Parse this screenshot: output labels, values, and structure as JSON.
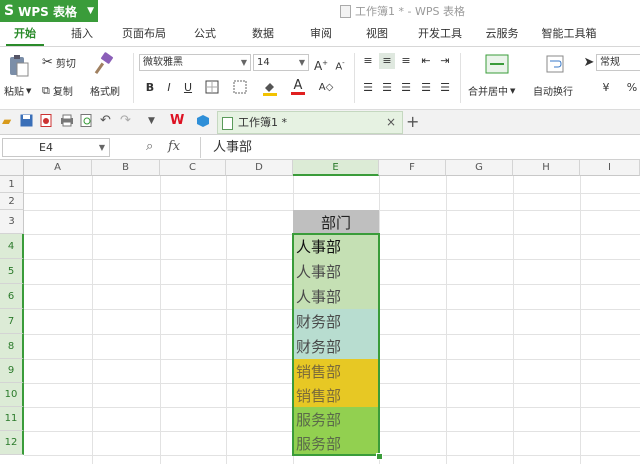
{
  "app": {
    "name": "WPS 表格",
    "logo": "S"
  },
  "window": {
    "title": "工作簿1 * - WPS 表格"
  },
  "tabs": [
    "开始",
    "插入",
    "页面布局",
    "公式",
    "数据",
    "审阅",
    "视图",
    "开发工具",
    "云服务",
    "智能工具箱"
  ],
  "ribbon": {
    "paste": "粘贴",
    "cut": "剪切",
    "copy": "复制",
    "format_painter": "格式刷",
    "font_name": "微软雅黑",
    "font_size": "14",
    "merge_center": "合并居中",
    "wrap_text": "自动换行",
    "number_format": "常规",
    "percent": "%"
  },
  "sheet_tab": {
    "label": "工作簿1 *",
    "close": "×",
    "add": "+"
  },
  "formula_bar": {
    "cell_ref": "E4",
    "fx": "fx",
    "content": "人事部"
  },
  "grid": {
    "columns": [
      "A",
      "B",
      "C",
      "D",
      "E",
      "F",
      "G",
      "H",
      "I"
    ],
    "rows": [
      "1",
      "2",
      "3",
      "4",
      "5",
      "6",
      "7",
      "8",
      "9",
      "10",
      "11",
      "12"
    ],
    "header_cell": "部门",
    "values": [
      "人事部",
      "人事部",
      "人事部",
      "财务部",
      "财务部",
      "销售部",
      "销售部",
      "服务部",
      "服务部"
    ]
  },
  "colors": {
    "accent": "#2a8b2a",
    "header_fill": "#bfbfbf",
    "hr_fill": "#c5e0b4",
    "finance_fill": "#b8ddd0",
    "sales_fill": "#e7c824",
    "service_fill": "#92d050"
  }
}
